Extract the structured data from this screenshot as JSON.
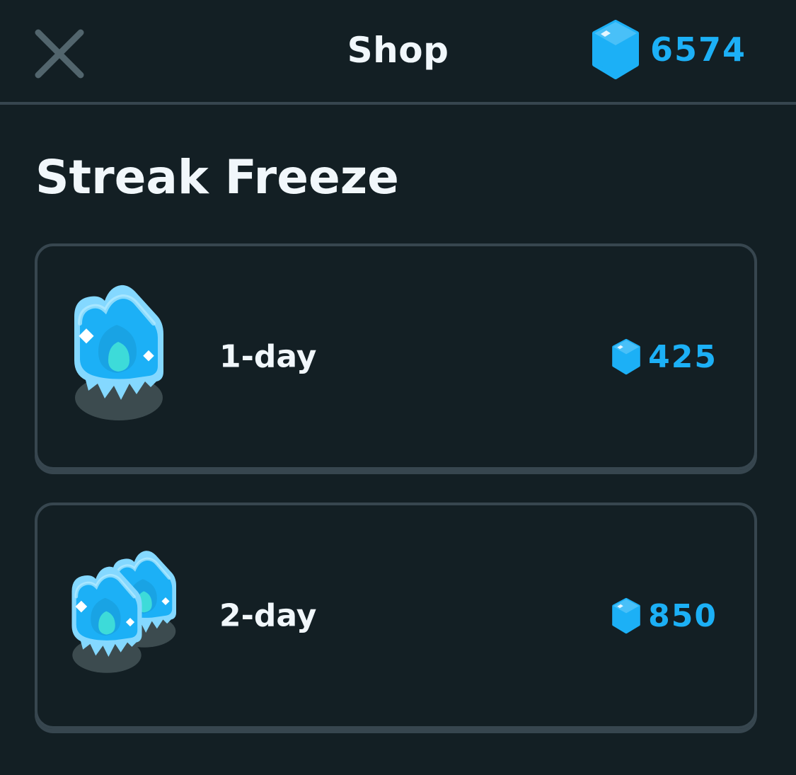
{
  "header": {
    "title": "Shop",
    "gem_count": "6574"
  },
  "section": {
    "title": "Streak Freeze"
  },
  "items": [
    {
      "label": "1-day",
      "price": "425",
      "icon": "streak-freeze-single-icon"
    },
    {
      "label": "2-day",
      "price": "850",
      "icon": "streak-freeze-double-icon"
    }
  ],
  "colors": {
    "background": "#131f24",
    "border": "#37464f",
    "text": "#f1f7fb",
    "gem_blue": "#1cb0f6",
    "close_icon": "#52656d"
  }
}
